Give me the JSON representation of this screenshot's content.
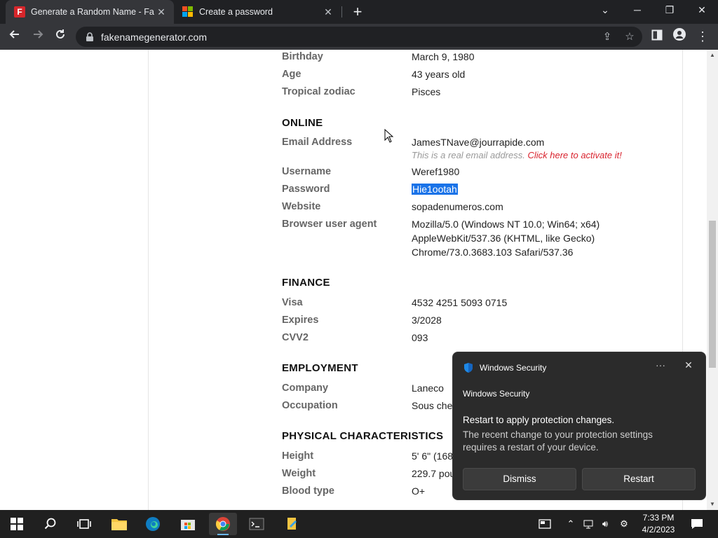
{
  "browser": {
    "tabs": [
      {
        "title": "Generate a Random Name - Fake Name Generator",
        "favicon": "fakename-icon"
      },
      {
        "title": "Create a password",
        "favicon": "microsoft-icon"
      }
    ],
    "url": "fakenamegenerator.com"
  },
  "profile": {
    "birthday_label": "Birthday",
    "birthday_value": "March 9, 1980",
    "age_label": "Age",
    "age_value": "43 years old",
    "zodiac_label": "Tropical zodiac",
    "zodiac_value": "Pisces",
    "online_heading": "ONLINE",
    "email_label": "Email Address",
    "email_value": "JamesTNave@jourrapide.com",
    "email_note": "This is a real email address.",
    "email_link": "Click here to activate it!",
    "username_label": "Username",
    "username_value": "Weref1980",
    "password_label": "Password",
    "password_value": "Hie1ootah",
    "website_label": "Website",
    "website_value": "sopadenumeros.com",
    "ua_label": "Browser user agent",
    "ua_line1": "Mozilla/5.0 (Windows NT 10.0; Win64; x64)",
    "ua_line2": "AppleWebKit/537.36 (KHTML, like Gecko)",
    "ua_line3": "Chrome/73.0.3683.103 Safari/537.36",
    "finance_heading": "FINANCE",
    "visa_label": "Visa",
    "visa_value": "4532 4251 5093 0715",
    "expires_label": "Expires",
    "expires_value": "3/2028",
    "cvv_label": "CVV2",
    "cvv_value": "093",
    "employment_heading": "EMPLOYMENT",
    "company_label": "Company",
    "company_value": "Laneco",
    "occupation_label": "Occupation",
    "occupation_value": "Sous chef",
    "physical_heading": "PHYSICAL CHARACTERISTICS",
    "height_label": "Height",
    "height_value": "5' 6\" (168",
    "weight_label": "Weight",
    "weight_value": "229.7 pou",
    "blood_label": "Blood type",
    "blood_value": "O+"
  },
  "notification": {
    "header": "Windows Security",
    "app_name": "Windows Security",
    "title": "Restart to apply protection changes.",
    "body": "The recent change to your protection settings requires a restart of your device.",
    "dismiss_label": "Dismiss",
    "restart_label": "Restart",
    "more_label": "···"
  },
  "taskbar": {
    "time": "7:33 PM",
    "date": "4/2/2023"
  },
  "colors": {
    "accent": "#1a73e8",
    "link_red": "#d9232e"
  }
}
